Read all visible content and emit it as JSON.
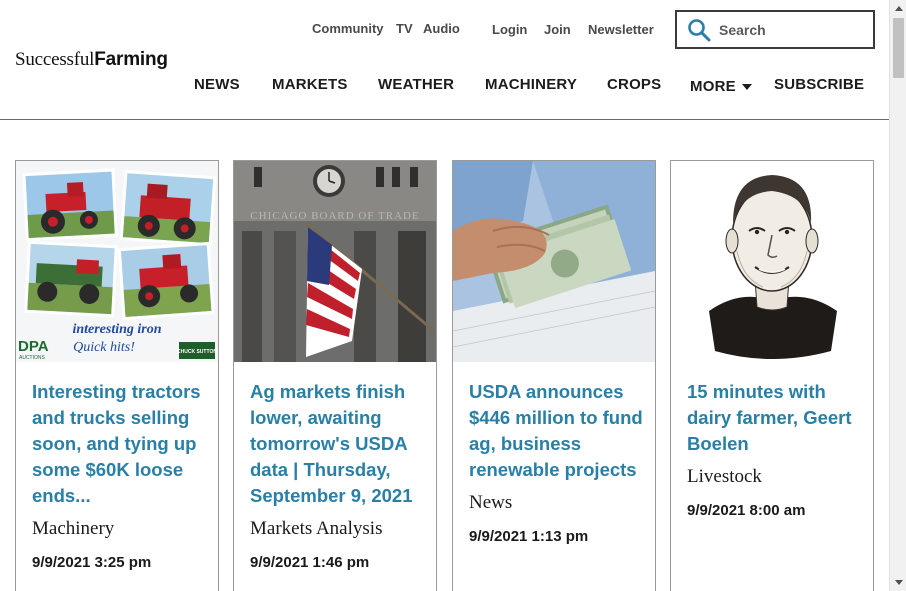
{
  "logo": {
    "part1": "Successful",
    "part2": "Farming"
  },
  "utility_nav": {
    "community": "Community",
    "tv": "TV",
    "audio": "Audio",
    "login": "Login",
    "join": "Join",
    "newsletter": "Newsletter"
  },
  "search": {
    "placeholder": "Search",
    "value": ""
  },
  "main_nav": {
    "news": "NEWS",
    "markets": "MARKETS",
    "weather": "WEATHER",
    "machinery": "MACHINERY",
    "crops": "CROPS",
    "more": "MORE",
    "subscribe": "SUBSCRIBE"
  },
  "cards": [
    {
      "title": "Interesting tractors and trucks selling soon, and tying up some $60K loose ends...",
      "category": "Machinery",
      "date": "9/9/2021 3:25 pm",
      "image": {
        "caption_line1": "interesting iron",
        "caption_line2": "Quick hits!",
        "logo_left": "DPA",
        "logo_left_sub": "AUCTIONS",
        "logo_right": "CHUCK SUTTON"
      }
    },
    {
      "title": "Ag markets finish lower, awaiting tomorrow's USDA data | Thursday, September 9, 2021",
      "category": "Markets Analysis",
      "date": "9/9/2021 1:46 pm",
      "image": {
        "building_text": "CHICAGO BOARD OF TRADE"
      }
    },
    {
      "title": "USDA announces $446 million to fund ag, business renewable projects",
      "category": "News",
      "date": "9/9/2021 1:13 pm"
    },
    {
      "title": "15 minutes with dairy farmer, Geert Boelen",
      "category": "Livestock",
      "date": "9/9/2021 8:00 am"
    }
  ],
  "colors": {
    "link": "#2a7fa6",
    "search_icon": "#2a7fa6",
    "header_rule": "#6b6b6b",
    "text": "#1a1a1a"
  },
  "icons": {
    "search": "search-icon",
    "more_caret": "chevron-down-icon",
    "scroll_up": "scroll-up-arrow-icon",
    "scroll_down": "scroll-down-arrow-icon"
  }
}
